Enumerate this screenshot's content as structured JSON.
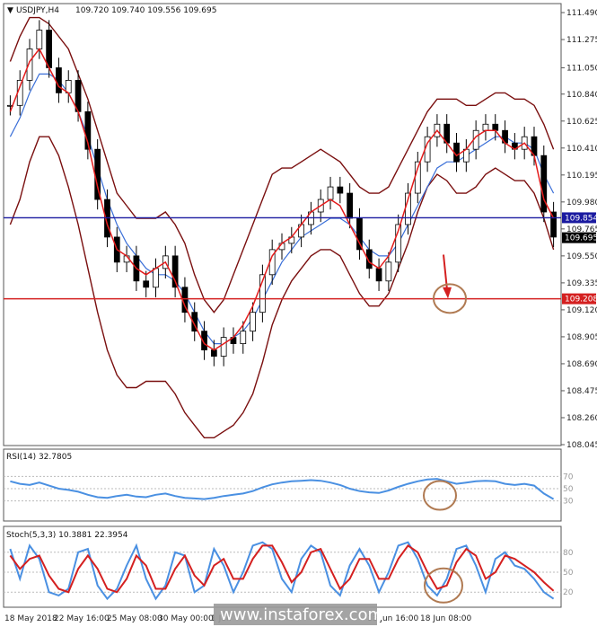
{
  "header": {
    "symbol_label": "USDJPY,H4",
    "ohlc": "109.720 109.740 109.556 109.695",
    "arrow": "▼"
  },
  "colors": {
    "candle": "#000000",
    "bollinger": "#7a0f0f",
    "ma_fast": "#e31b1b",
    "ma_slow": "#3a6fd8",
    "support_line": "#1a1aa0",
    "target_line": "#d42020",
    "indicator_blue": "#4a90e2",
    "indicator_red": "#d42020",
    "marker_circle": "#b07a52",
    "arrow": "#d42020"
  },
  "chart_data": [
    {
      "type": "candlestick",
      "title": "USDJPY,H4",
      "price_axis_ticks": [
        "111.490",
        "111.275",
        "111.050",
        "110.840",
        "110.625",
        "110.410",
        "110.195",
        "109.980",
        "109.765",
        "109.550",
        "109.335",
        "109.120",
        "108.905",
        "108.690",
        "108.475",
        "108.260",
        "108.045"
      ],
      "ylim": [
        108.045,
        111.49
      ],
      "time_axis_ticks": [
        "18 May 2018",
        "22 May 16:00",
        "25 May 08:00",
        "30 May 00:00",
        "1 Jun",
        "13 Jun 16:00",
        "18 Jun 08:00"
      ],
      "horizontal_levels": [
        {
          "value": 109.854,
          "label": "109.854",
          "color": "#1a1aa0"
        },
        {
          "value": 109.208,
          "label": "109.208",
          "color": "#d42020"
        }
      ],
      "current_price": {
        "value": 109.695,
        "label": "109.695"
      },
      "close": [
        110.75,
        110.95,
        111.2,
        111.35,
        111.05,
        110.85,
        110.95,
        110.7,
        110.4,
        110.0,
        109.7,
        109.5,
        109.55,
        109.35,
        109.3,
        109.45,
        109.55,
        109.3,
        109.1,
        108.95,
        108.8,
        108.75,
        108.9,
        108.85,
        108.95,
        109.1,
        109.4,
        109.6,
        109.65,
        109.7,
        109.8,
        109.9,
        110.0,
        110.1,
        110.05,
        109.85,
        109.6,
        109.45,
        109.35,
        109.5,
        109.8,
        110.05,
        110.3,
        110.5,
        110.6,
        110.45,
        110.3,
        110.4,
        110.55,
        110.6,
        110.55,
        110.45,
        110.4,
        110.5,
        110.35,
        109.9,
        109.7
      ],
      "upper_band": [
        111.1,
        111.3,
        111.45,
        111.45,
        111.4,
        111.3,
        111.2,
        111.0,
        110.8,
        110.55,
        110.3,
        110.05,
        109.95,
        109.85,
        109.85,
        109.85,
        109.9,
        109.8,
        109.65,
        109.4,
        109.2,
        109.1,
        109.2,
        109.4,
        109.6,
        109.8,
        110.0,
        110.2,
        110.25,
        110.25,
        110.3,
        110.35,
        110.4,
        110.35,
        110.3,
        110.2,
        110.1,
        110.05,
        110.05,
        110.1,
        110.25,
        110.4,
        110.55,
        110.7,
        110.8,
        110.8,
        110.8,
        110.75,
        110.75,
        110.8,
        110.85,
        110.85,
        110.8,
        110.8,
        110.75,
        110.6,
        110.4
      ],
      "lower_band": [
        109.8,
        110.0,
        110.3,
        110.5,
        110.5,
        110.35,
        110.1,
        109.8,
        109.45,
        109.1,
        108.8,
        108.6,
        108.5,
        108.5,
        108.55,
        108.55,
        108.55,
        108.45,
        108.3,
        108.2,
        108.1,
        108.1,
        108.15,
        108.2,
        108.3,
        108.45,
        108.7,
        109.0,
        109.2,
        109.35,
        109.45,
        109.55,
        109.6,
        109.6,
        109.55,
        109.4,
        109.25,
        109.15,
        109.15,
        109.25,
        109.45,
        109.65,
        109.9,
        110.1,
        110.2,
        110.15,
        110.05,
        110.05,
        110.1,
        110.2,
        110.25,
        110.2,
        110.15,
        110.15,
        110.05,
        109.85,
        109.6
      ],
      "ma_fast": [
        110.7,
        110.9,
        111.1,
        111.2,
        111.05,
        110.9,
        110.85,
        110.7,
        110.45,
        110.1,
        109.8,
        109.6,
        109.55,
        109.45,
        109.4,
        109.45,
        109.5,
        109.35,
        109.15,
        109.0,
        108.85,
        108.8,
        108.85,
        108.9,
        109.0,
        109.15,
        109.35,
        109.55,
        109.65,
        109.7,
        109.8,
        109.9,
        109.95,
        110.0,
        109.95,
        109.8,
        109.65,
        109.5,
        109.45,
        109.55,
        109.75,
        110.0,
        110.25,
        110.45,
        110.55,
        110.45,
        110.35,
        110.4,
        110.5,
        110.55,
        110.55,
        110.45,
        110.4,
        110.45,
        110.35,
        110.0,
        109.85
      ],
      "ma_slow": [
        110.5,
        110.65,
        110.85,
        111.0,
        111.0,
        110.95,
        110.85,
        110.7,
        110.5,
        110.25,
        110.0,
        109.8,
        109.65,
        109.55,
        109.45,
        109.4,
        109.4,
        109.35,
        109.25,
        109.1,
        108.95,
        108.85,
        108.85,
        108.9,
        108.95,
        109.05,
        109.2,
        109.35,
        109.5,
        109.6,
        109.7,
        109.75,
        109.8,
        109.85,
        109.85,
        109.8,
        109.7,
        109.6,
        109.55,
        109.55,
        109.65,
        109.8,
        109.95,
        110.1,
        110.25,
        110.3,
        110.3,
        110.35,
        110.4,
        110.45,
        110.5,
        110.5,
        110.45,
        110.45,
        110.4,
        110.2,
        110.05
      ]
    },
    {
      "type": "line",
      "title": "RSI(14) 32.7805",
      "level_ticks": [
        "70",
        "50",
        "30"
      ],
      "ylim": [
        0,
        100
      ],
      "series": [
        {
          "name": "RSI",
          "values": [
            62,
            58,
            56,
            60,
            55,
            50,
            48,
            45,
            40,
            36,
            35,
            38,
            40,
            37,
            36,
            40,
            42,
            38,
            35,
            34,
            33,
            35,
            38,
            40,
            42,
            46,
            52,
            57,
            60,
            62,
            63,
            64,
            63,
            60,
            56,
            50,
            46,
            44,
            43,
            47,
            53,
            58,
            62,
            65,
            66,
            62,
            58,
            60,
            62,
            63,
            62,
            58,
            56,
            58,
            55,
            42,
            33
          ]
        }
      ]
    },
    {
      "type": "line",
      "title": "Stoch(5,3,3) 10.3881 22.3954",
      "level_ticks": [
        "80",
        "50",
        "20"
      ],
      "ylim": [
        0,
        100
      ],
      "series": [
        {
          "name": "Stoch %K",
          "values": [
            85,
            40,
            90,
            70,
            20,
            15,
            25,
            80,
            85,
            30,
            10,
            25,
            60,
            90,
            40,
            10,
            30,
            80,
            75,
            20,
            30,
            85,
            60,
            20,
            50,
            90,
            95,
            85,
            40,
            20,
            70,
            90,
            80,
            30,
            15,
            60,
            85,
            60,
            20,
            50,
            90,
            95,
            70,
            30,
            15,
            40,
            85,
            90,
            60,
            20,
            70,
            80,
            60,
            55,
            40,
            20,
            10
          ]
        },
        {
          "name": "Stoch %D",
          "values": [
            75,
            55,
            70,
            75,
            45,
            25,
            20,
            55,
            75,
            55,
            25,
            20,
            40,
            75,
            60,
            25,
            25,
            55,
            75,
            45,
            30,
            60,
            70,
            40,
            40,
            70,
            90,
            90,
            65,
            35,
            50,
            80,
            85,
            55,
            25,
            40,
            70,
            70,
            40,
            40,
            70,
            90,
            80,
            50,
            25,
            30,
            65,
            85,
            75,
            40,
            50,
            75,
            70,
            60,
            50,
            35,
            22
          ]
        }
      ]
    }
  ],
  "watermark": "www.instaforex.com"
}
